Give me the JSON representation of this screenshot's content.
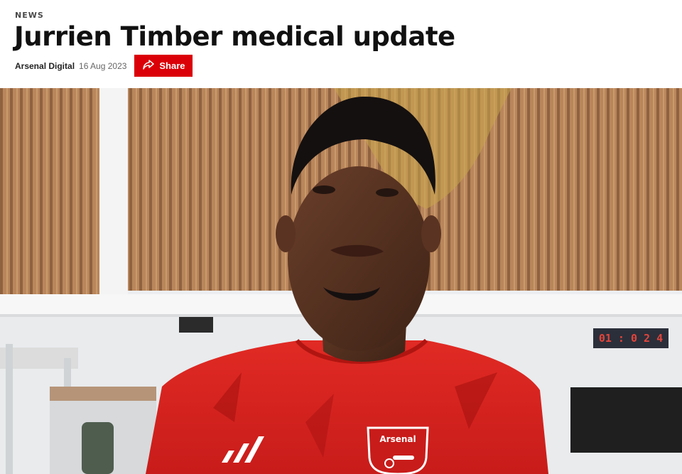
{
  "article": {
    "category": "NEWS",
    "title": "Jurrien Timber medical update",
    "author": "Arsenal Digital",
    "date": "16 Aug 2023"
  },
  "actions": {
    "share_label": "Share",
    "share_icon": "share-arrow-icon"
  },
  "hero": {
    "crest_text": "Arsenal",
    "scoreboard": "01 : 0 2 4",
    "colors": {
      "accent": "#db0007",
      "shirt": "#d8231f",
      "wood": "#b8855a",
      "wall": "#eef0f1"
    }
  }
}
